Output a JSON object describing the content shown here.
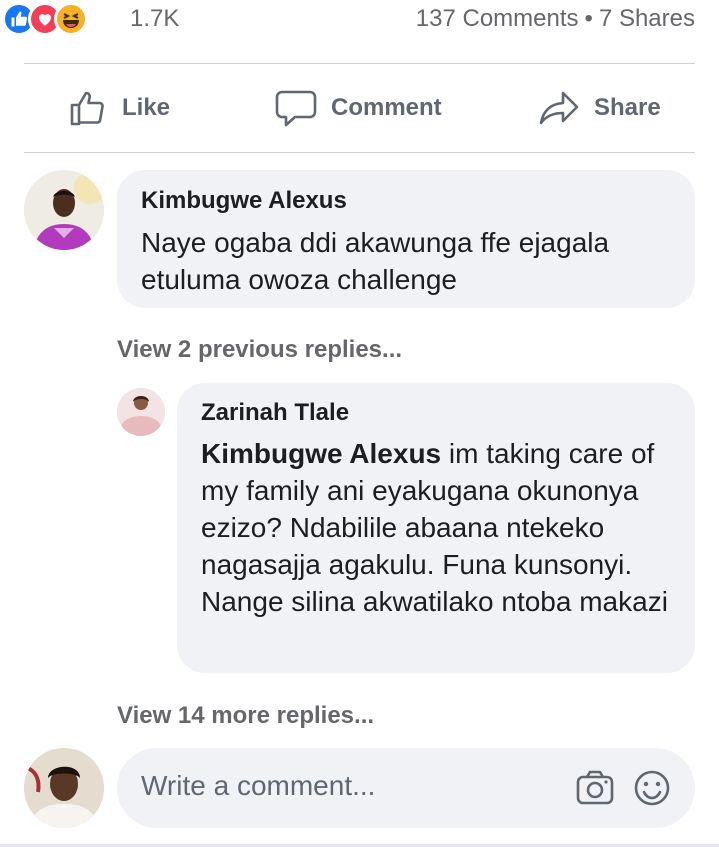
{
  "reactions": {
    "count": "1.7K",
    "icons": [
      "like-icon",
      "love-icon",
      "haha-icon"
    ],
    "comments_count": "137 Comments",
    "separator": "•",
    "shares_count": "7 Shares"
  },
  "actions": {
    "like": "Like",
    "comment": "Comment",
    "share": "Share"
  },
  "comment": {
    "author": "Kimbugwe Alexus",
    "text": "Naye ogaba ddi akawunga ffe ejagala etuluma owoza challenge"
  },
  "view_previous": "View 2 previous replies...",
  "reply": {
    "author": "Zarinah Tlale",
    "mention": "Kimbugwe Alexus",
    "text": " im taking care of my family ani eyakugana okunonya ezizo? Ndabilile abaana ntekeko nagasajja agakulu. Funa kunsonyi. Nange silina akwatilako  ntoba makazi"
  },
  "view_more": "View 14 more replies...",
  "composer": {
    "placeholder": "Write a comment..."
  },
  "colors": {
    "accent": "#1877f2",
    "love": "#f33e58",
    "haha": "#f7b125",
    "bubble": "#f0f2f5",
    "muted_text": "#65676b"
  }
}
